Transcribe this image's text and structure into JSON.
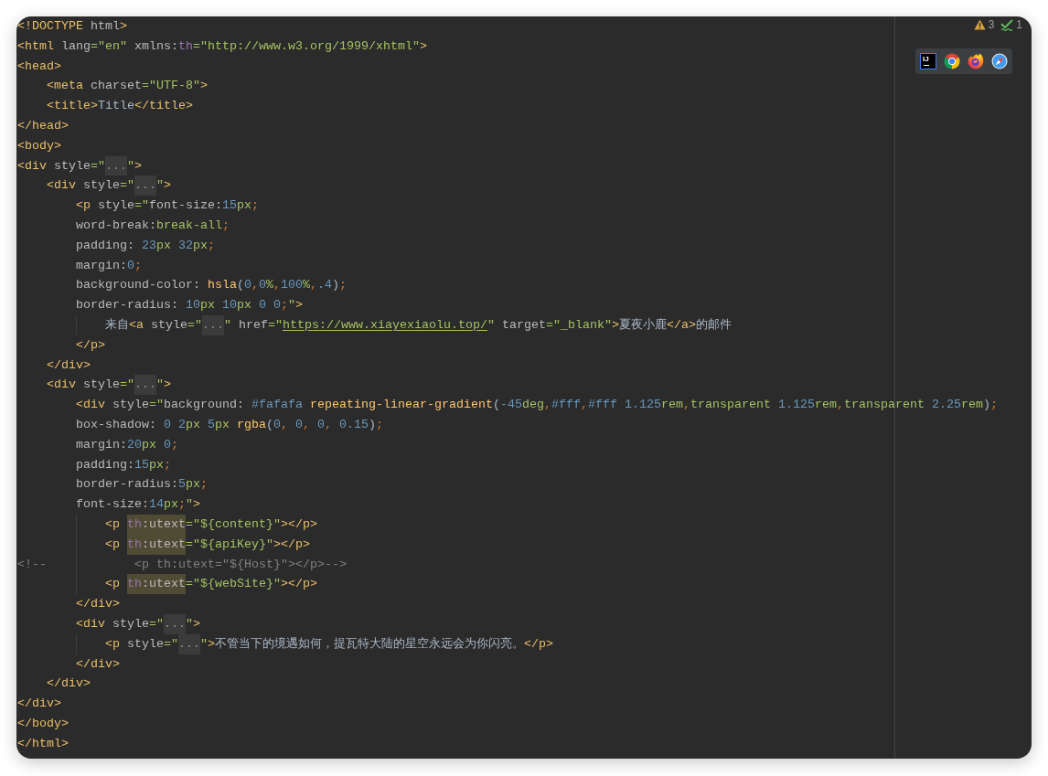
{
  "editor": {
    "lines": [
      {
        "tokens": [
          {
            "kind": "tag",
            "text": "<!DOCTYPE"
          },
          {
            "kind": "attr",
            "text": " html"
          },
          {
            "kind": "tag",
            "text": ">"
          }
        ]
      },
      {
        "tokens": [
          {
            "kind": "tag",
            "text": "<html"
          },
          {
            "kind": "attr",
            "text": " lang"
          },
          {
            "kind": "string",
            "text": "=\"en\""
          },
          {
            "kind": "attr",
            "text": " xmlns:"
          },
          {
            "kind": "ns",
            "text": "th"
          },
          {
            "kind": "string",
            "text": "=\"http://www.w3.org/1999/xhtml\""
          },
          {
            "kind": "tag",
            "text": ">"
          }
        ]
      },
      {
        "tokens": [
          {
            "kind": "tag",
            "text": "<head>"
          }
        ]
      },
      {
        "tokens": [
          {
            "kind": "tag",
            "text": "    <meta"
          },
          {
            "kind": "attr",
            "text": " charset"
          },
          {
            "kind": "string",
            "text": "=\"UTF-8\""
          },
          {
            "kind": "tag",
            "text": ">"
          }
        ]
      },
      {
        "tokens": [
          {
            "kind": "tag",
            "text": "    <title>"
          },
          {
            "kind": "text",
            "text": "Title"
          },
          {
            "kind": "tag",
            "text": "</title>"
          }
        ]
      },
      {
        "tokens": [
          {
            "kind": "tag",
            "text": "</head>"
          }
        ]
      },
      {
        "tokens": [
          {
            "kind": "tag",
            "text": "<body>"
          }
        ]
      },
      {
        "tokens": [
          {
            "kind": "tag",
            "text": "<div"
          },
          {
            "kind": "attr",
            "text": " style"
          },
          {
            "kind": "string",
            "text": "=\""
          },
          {
            "kind": "fold",
            "text": "..."
          },
          {
            "kind": "string",
            "text": "\""
          },
          {
            "kind": "tag",
            "text": ">"
          }
        ]
      },
      {
        "tokens": [
          {
            "kind": "tag",
            "text": "    <div"
          },
          {
            "kind": "attr",
            "text": " style"
          },
          {
            "kind": "string",
            "text": "=\""
          },
          {
            "kind": "fold",
            "text": "..."
          },
          {
            "kind": "string",
            "text": "\""
          },
          {
            "kind": "tag",
            "text": ">"
          }
        ]
      },
      {
        "tokens": [
          {
            "kind": "tag",
            "text": "        <p"
          },
          {
            "kind": "attr",
            "text": " style"
          },
          {
            "kind": "string",
            "text": "=\""
          },
          {
            "kind": "prop",
            "text": "font-size:"
          },
          {
            "kind": "number",
            "text": "15"
          },
          {
            "kind": "unit",
            "text": "px"
          },
          {
            "kind": "punct",
            "text": ";"
          }
        ]
      },
      {
        "tokens": [
          {
            "kind": "prop",
            "text": "        word-break:"
          },
          {
            "kind": "value",
            "text": "break-all"
          },
          {
            "kind": "punct",
            "text": ";"
          }
        ]
      },
      {
        "tokens": [
          {
            "kind": "prop",
            "text": "        padding: "
          },
          {
            "kind": "number",
            "text": "23"
          },
          {
            "kind": "unit",
            "text": "px"
          },
          {
            "kind": "number",
            "text": " 32"
          },
          {
            "kind": "unit",
            "text": "px"
          },
          {
            "kind": "punct",
            "text": ";"
          }
        ]
      },
      {
        "tokens": [
          {
            "kind": "prop",
            "text": "        margin:"
          },
          {
            "kind": "number",
            "text": "0"
          },
          {
            "kind": "punct",
            "text": ";"
          }
        ]
      },
      {
        "tokens": [
          {
            "kind": "prop",
            "text": "        background-color: "
          },
          {
            "kind": "func",
            "text": "hsla"
          },
          {
            "kind": "plain",
            "text": "("
          },
          {
            "kind": "number",
            "text": "0"
          },
          {
            "kind": "punct",
            "text": ","
          },
          {
            "kind": "number",
            "text": "0"
          },
          {
            "kind": "unit",
            "text": "%"
          },
          {
            "kind": "punct",
            "text": ","
          },
          {
            "kind": "number",
            "text": "100"
          },
          {
            "kind": "unit",
            "text": "%"
          },
          {
            "kind": "punct",
            "text": ","
          },
          {
            "kind": "number",
            "text": ".4"
          },
          {
            "kind": "plain",
            "text": ")"
          },
          {
            "kind": "punct",
            "text": ";"
          }
        ]
      },
      {
        "tokens": [
          {
            "kind": "prop",
            "text": "        border-radius: "
          },
          {
            "kind": "number",
            "text": "10"
          },
          {
            "kind": "unit",
            "text": "px"
          },
          {
            "kind": "number",
            "text": " 10"
          },
          {
            "kind": "unit",
            "text": "px"
          },
          {
            "kind": "number",
            "text": " 0"
          },
          {
            "kind": "number",
            "text": " 0"
          },
          {
            "kind": "punct",
            "text": ";"
          },
          {
            "kind": "string",
            "text": "\""
          },
          {
            "kind": "tag",
            "text": ">"
          }
        ]
      },
      {
        "tokens": [
          {
            "kind": "text",
            "text": "            来自"
          },
          {
            "kind": "tag",
            "text": "<a"
          },
          {
            "kind": "attr",
            "text": " style"
          },
          {
            "kind": "string",
            "text": "=\""
          },
          {
            "kind": "fold",
            "text": "..."
          },
          {
            "kind": "string",
            "text": "\""
          },
          {
            "kind": "attr",
            "text": " href"
          },
          {
            "kind": "string",
            "text": "=\""
          },
          {
            "kind": "url",
            "text": "https://www.xiayexiaolu.top/"
          },
          {
            "kind": "string",
            "text": "\""
          },
          {
            "kind": "attr",
            "text": " target"
          },
          {
            "kind": "string",
            "text": "=\"_blank\""
          },
          {
            "kind": "tag",
            "text": ">"
          },
          {
            "kind": "text",
            "text": "夏夜小鹿"
          },
          {
            "kind": "tag",
            "text": "</a>"
          },
          {
            "kind": "text",
            "text": "的邮件"
          }
        ]
      },
      {
        "tokens": [
          {
            "kind": "tag",
            "text": "        </p>"
          }
        ]
      },
      {
        "tokens": [
          {
            "kind": "tag",
            "text": "    </div>"
          }
        ]
      },
      {
        "tokens": [
          {
            "kind": "tag",
            "text": "    <div"
          },
          {
            "kind": "attr",
            "text": " style"
          },
          {
            "kind": "string",
            "text": "=\""
          },
          {
            "kind": "fold",
            "text": "..."
          },
          {
            "kind": "string",
            "text": "\""
          },
          {
            "kind": "tag",
            "text": ">"
          }
        ]
      },
      {
        "tokens": [
          {
            "kind": "tag",
            "text": "        <div"
          },
          {
            "kind": "attr",
            "text": " style"
          },
          {
            "kind": "string",
            "text": "=\""
          },
          {
            "kind": "prop",
            "text": "background: "
          },
          {
            "kind": "number",
            "text": "#fafafa"
          },
          {
            "kind": "func",
            "text": " repeating-linear-gradient"
          },
          {
            "kind": "plain",
            "text": "("
          },
          {
            "kind": "number",
            "text": "-45"
          },
          {
            "kind": "unit",
            "text": "deg"
          },
          {
            "kind": "punct",
            "text": ","
          },
          {
            "kind": "number",
            "text": "#fff"
          },
          {
            "kind": "punct",
            "text": ","
          },
          {
            "kind": "number",
            "text": "#fff"
          },
          {
            "kind": "number",
            "text": " 1.125"
          },
          {
            "kind": "unit",
            "text": "rem"
          },
          {
            "kind": "punct",
            "text": ","
          },
          {
            "kind": "value",
            "text": "transparent"
          },
          {
            "kind": "number",
            "text": " 1.125"
          },
          {
            "kind": "unit",
            "text": "rem"
          },
          {
            "kind": "punct",
            "text": ","
          },
          {
            "kind": "value",
            "text": "transparent"
          },
          {
            "kind": "number",
            "text": " 2.25"
          },
          {
            "kind": "unit",
            "text": "rem"
          },
          {
            "kind": "plain",
            "text": ")"
          },
          {
            "kind": "punct",
            "text": ";"
          }
        ]
      },
      {
        "tokens": [
          {
            "kind": "prop",
            "text": "        box-shadow: "
          },
          {
            "kind": "number",
            "text": "0"
          },
          {
            "kind": "number",
            "text": " 2"
          },
          {
            "kind": "unit",
            "text": "px"
          },
          {
            "kind": "number",
            "text": " 5"
          },
          {
            "kind": "unit",
            "text": "px"
          },
          {
            "kind": "func",
            "text": " rgba"
          },
          {
            "kind": "plain",
            "text": "("
          },
          {
            "kind": "number",
            "text": "0"
          },
          {
            "kind": "punct",
            "text": ", "
          },
          {
            "kind": "number",
            "text": "0"
          },
          {
            "kind": "punct",
            "text": ", "
          },
          {
            "kind": "number",
            "text": "0"
          },
          {
            "kind": "punct",
            "text": ", "
          },
          {
            "kind": "number",
            "text": "0.15"
          },
          {
            "kind": "plain",
            "text": ")"
          },
          {
            "kind": "punct",
            "text": ";"
          }
        ]
      },
      {
        "tokens": [
          {
            "kind": "prop",
            "text": "        margin:"
          },
          {
            "kind": "number",
            "text": "20"
          },
          {
            "kind": "unit",
            "text": "px"
          },
          {
            "kind": "number",
            "text": " 0"
          },
          {
            "kind": "punct",
            "text": ";"
          }
        ]
      },
      {
        "tokens": [
          {
            "kind": "prop",
            "text": "        padding:"
          },
          {
            "kind": "number",
            "text": "15"
          },
          {
            "kind": "unit",
            "text": "px"
          },
          {
            "kind": "punct",
            "text": ";"
          }
        ]
      },
      {
        "tokens": [
          {
            "kind": "prop",
            "text": "        border-radius:"
          },
          {
            "kind": "number",
            "text": "5"
          },
          {
            "kind": "unit",
            "text": "px"
          },
          {
            "kind": "punct",
            "text": ";"
          }
        ]
      },
      {
        "tokens": [
          {
            "kind": "prop",
            "text": "        font-size:"
          },
          {
            "kind": "number",
            "text": "14"
          },
          {
            "kind": "unit",
            "text": "px"
          },
          {
            "kind": "punct",
            "text": ";"
          },
          {
            "kind": "string",
            "text": "\""
          },
          {
            "kind": "tag",
            "text": ">"
          }
        ]
      },
      {
        "tokens": [
          {
            "kind": "tag",
            "text": "            <p "
          },
          {
            "kind": "usage",
            "parts": [
              {
                "kind": "ns",
                "text": "th"
              },
              {
                "kind": "attr",
                "text": ":utext"
              }
            ]
          },
          {
            "kind": "string",
            "text": "=\"${content}\""
          },
          {
            "kind": "tag",
            "text": "></p>"
          }
        ]
      },
      {
        "tokens": [
          {
            "kind": "tag",
            "text": "            <p "
          },
          {
            "kind": "usage",
            "parts": [
              {
                "kind": "ns",
                "text": "th"
              },
              {
                "kind": "attr",
                "text": ":utext"
              }
            ]
          },
          {
            "kind": "string",
            "text": "=\"${apiKey}\""
          },
          {
            "kind": "tag",
            "text": "></p>"
          }
        ]
      },
      {
        "tokens": [
          {
            "kind": "comment",
            "text": "<!--            <p th:utext=\"${Host}\"></p>-->"
          }
        ]
      },
      {
        "tokens": [
          {
            "kind": "tag",
            "text": "            <p "
          },
          {
            "kind": "usage",
            "parts": [
              {
                "kind": "ns",
                "text": "th"
              },
              {
                "kind": "attr",
                "text": ":utext"
              }
            ]
          },
          {
            "kind": "string",
            "text": "=\"${webSite}\""
          },
          {
            "kind": "tag",
            "text": "></p>"
          }
        ]
      },
      {
        "tokens": [
          {
            "kind": "tag",
            "text": "        </div>"
          }
        ]
      },
      {
        "tokens": [
          {
            "kind": "tag",
            "text": "        <div"
          },
          {
            "kind": "attr",
            "text": " style"
          },
          {
            "kind": "string",
            "text": "=\""
          },
          {
            "kind": "fold",
            "text": "..."
          },
          {
            "kind": "string",
            "text": "\""
          },
          {
            "kind": "tag",
            "text": ">"
          }
        ]
      },
      {
        "tokens": [
          {
            "kind": "tag",
            "text": "            <p"
          },
          {
            "kind": "attr",
            "text": " style"
          },
          {
            "kind": "string",
            "text": "=\""
          },
          {
            "kind": "fold",
            "text": "..."
          },
          {
            "kind": "string",
            "text": "\""
          },
          {
            "kind": "tag",
            "text": ">"
          },
          {
            "kind": "text",
            "text": "不管当下的境遇如何，提瓦特大陆的星空永远会为你闪亮。"
          },
          {
            "kind": "tag",
            "text": "</p>"
          }
        ]
      },
      {
        "tokens": [
          {
            "kind": "tag",
            "text": "        </div>"
          }
        ]
      },
      {
        "tokens": [
          {
            "kind": "tag",
            "text": "    </div>"
          }
        ]
      },
      {
        "tokens": [
          {
            "kind": "tag",
            "text": "</div>"
          }
        ]
      },
      {
        "tokens": [
          {
            "kind": "tag",
            "text": "</body>"
          }
        ]
      },
      {
        "tokens": [
          {
            "kind": "tag",
            "text": "</html>"
          }
        ]
      }
    ]
  },
  "inspections": [
    {
      "kind": "warning",
      "count": "3"
    },
    {
      "kind": "typo",
      "count": "1"
    }
  ],
  "browser_popup": {
    "items": [
      {
        "kind": "ide",
        "label": "IJ",
        "selected": true
      },
      {
        "kind": "chrome",
        "selected": false
      },
      {
        "kind": "firefox",
        "selected": false
      },
      {
        "kind": "safari",
        "selected": false
      }
    ]
  }
}
